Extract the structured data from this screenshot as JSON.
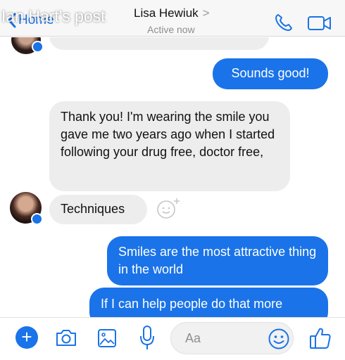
{
  "overlay": {
    "title": "Ian Hart's post"
  },
  "header": {
    "back_label": "Home",
    "contact_name": "Lisa Hewiuk",
    "contact_chevron": ">",
    "status": "Active now"
  },
  "messages": [
    {
      "direction": "outgoing",
      "text": "Sounds good!"
    },
    {
      "direction": "incoming",
      "text": "Thank you! I'm wearing the smile you gave me two years ago when I started following your drug free, doctor free,"
    },
    {
      "direction": "incoming",
      "text": "Techniques"
    },
    {
      "direction": "outgoing",
      "text": "Smiles are the most attractive thing in the world"
    },
    {
      "direction": "outgoing",
      "text": "If I can help people do that more"
    }
  ],
  "composer": {
    "plus_label": "+",
    "placeholder": "Aa"
  },
  "icons": {
    "back": "chevron-left-icon",
    "call": "phone-icon",
    "video": "video-camera-icon",
    "react": "add-reaction-icon",
    "camera": "camera-icon",
    "photo": "photo-gallery-icon",
    "mic": "microphone-icon",
    "emoji": "smiley-icon",
    "like": "thumbs-up-icon"
  },
  "colors": {
    "accent": "#1a73e8",
    "incoming_bubble": "#ededee",
    "outgoing_bubble": "#1a73e8"
  }
}
